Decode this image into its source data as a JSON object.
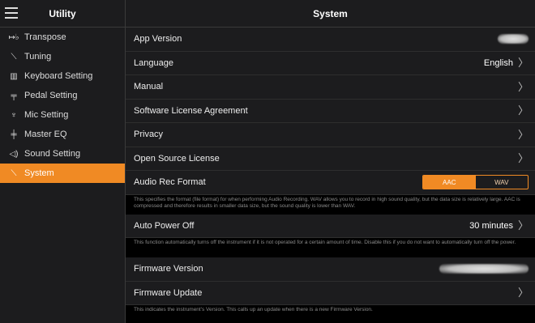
{
  "sidebar": {
    "title": "Utility",
    "items": [
      {
        "label": "Transpose",
        "icon": "transpose-icon",
        "glyph": "↦♭"
      },
      {
        "label": "Tuning",
        "icon": "tuning-icon",
        "glyph": "⟍"
      },
      {
        "label": "Keyboard Setting",
        "icon": "keyboard-icon",
        "glyph": "▥"
      },
      {
        "label": "Pedal Setting",
        "icon": "pedal-icon",
        "glyph": "╤"
      },
      {
        "label": "Mic Setting",
        "icon": "mic-icon",
        "glyph": "♆"
      },
      {
        "label": "Master EQ",
        "icon": "eq-icon",
        "glyph": "╪"
      },
      {
        "label": "Sound Setting",
        "icon": "sound-icon",
        "glyph": "◁)"
      },
      {
        "label": "System",
        "icon": "system-icon",
        "glyph": "⟍"
      }
    ],
    "active_index": 7
  },
  "main": {
    "title": "System",
    "app_version_label": "App Version",
    "language_label": "Language",
    "language_value": "English",
    "manual_label": "Manual",
    "license_label": "Software License Agreement",
    "privacy_label": "Privacy",
    "open_source_label": "Open Source License",
    "audio_rec_label": "Audio Rec Format",
    "audio_rec_options": [
      "AAC",
      "WAV"
    ],
    "audio_rec_selected": "AAC",
    "audio_rec_note": "This specifies the format (file format) for when performing Audio Recording. WAV allows you to record in high sound quality, but the data size is relatively large. AAC is compressed and therefore results in smaller data size, but the sound quality is lower than WAV.",
    "auto_power_label": "Auto Power Off",
    "auto_power_value": "30 minutes",
    "auto_power_note": "This function automatically turns off the instrument if it is not operated for a certain amount of time. Disable this if you do not want to automatically turn off the power.",
    "firmware_version_label": "Firmware Version",
    "firmware_update_label": "Firmware Update",
    "firmware_note": "This indicates the instrument's Version. This calls up an update when there is a new Firmware Version."
  },
  "colors": {
    "accent": "#f08a24",
    "panel": "#1c1c1e",
    "background": "#000000"
  }
}
